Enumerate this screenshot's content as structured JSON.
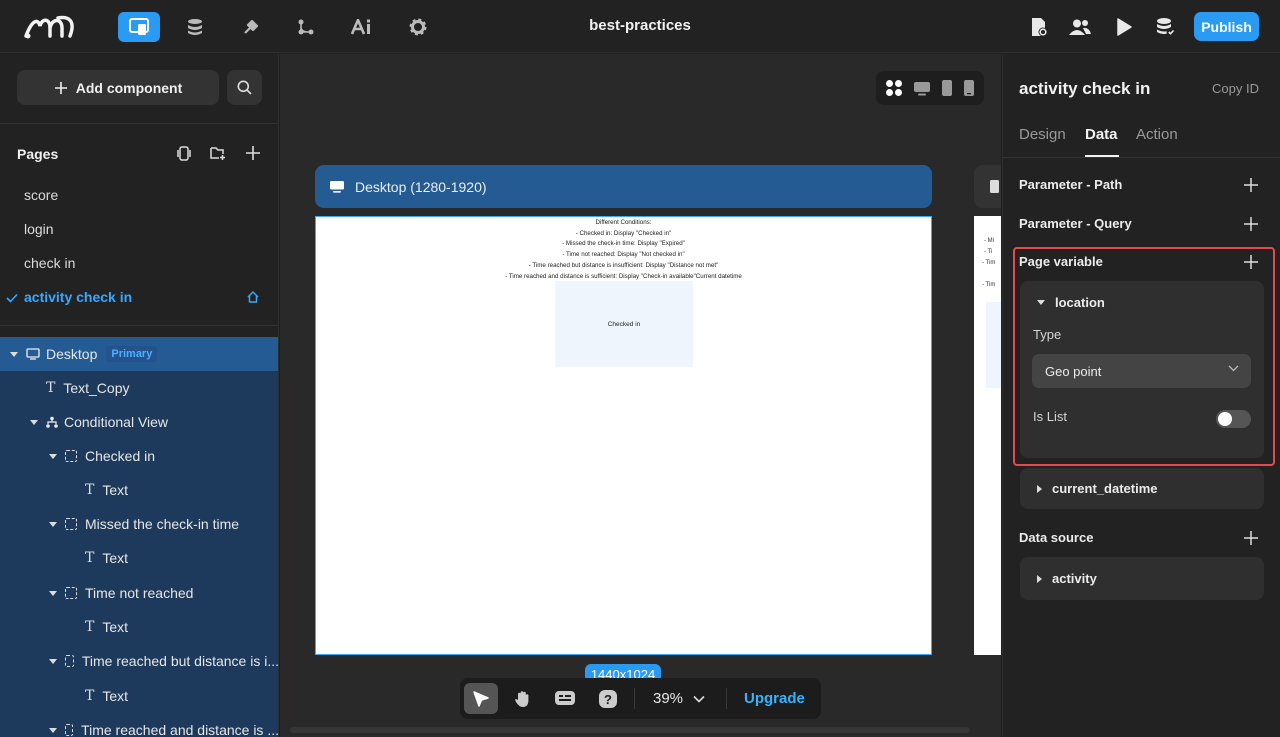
{
  "topbar": {
    "title": "best-practices",
    "publish_label": "Publish",
    "tools": [
      "layout-icon",
      "database-icon",
      "plugin-icon",
      "flow-icon",
      "ai-icon",
      "gear-icon"
    ],
    "right_icons": [
      "page-settings-icon",
      "users-icon",
      "play-icon",
      "data-icon"
    ],
    "accent": "#2b9af3"
  },
  "left": {
    "add_component_label": "Add component",
    "pages_title": "Pages",
    "pages": [
      "score",
      "login",
      "check in",
      "activity check in"
    ],
    "tree": {
      "desktop": "Desktop",
      "primary_badge": "Primary",
      "text_copy": "Text_Copy",
      "conditional_view": "Conditional View",
      "checked_in": "Checked in",
      "text": "Text",
      "missed": "Missed the check-in time",
      "not_reached": "Time not reached",
      "reached_insufficient": "Time reached but distance is i...",
      "reached_sufficient": "Time reached and distance is ..."
    }
  },
  "canvas": {
    "frame_label": "Desktop (1280-1920)",
    "frame_lines": [
      "Different Conditions:",
      "- Checked in: Display \"Checked in\"",
      "- Missed the check-in time: Display \"Expired\"",
      "- Time not reached: Display \"Not checked in\"",
      "- Time reached but distance is insufficient: Display \"Distance not met\"",
      "- Time reached and distance is sufficient: Display \"Check-in available\"Current datetime"
    ],
    "checked_in_box": "Checked in",
    "right_frame_lines": [
      "- Mi",
      "- Ti",
      "- Tim",
      "- Tim"
    ],
    "size_tag": "1440x1024",
    "zoom": "39%",
    "upgrade_label": "Upgrade"
  },
  "right": {
    "component_title": "activity check in",
    "copy_id": "Copy ID",
    "tabs": [
      "Design",
      "Data",
      "Action"
    ],
    "param_path": "Parameter - Path",
    "param_query": "Parameter - Query",
    "page_variable": "Page variable",
    "location_var": "location",
    "type_label": "Type",
    "type_value": "Geo point",
    "is_list_label": "Is List",
    "is_list_on": false,
    "current_datetime_var": "current_datetime",
    "data_source": "Data source",
    "activity_source": "activity"
  }
}
